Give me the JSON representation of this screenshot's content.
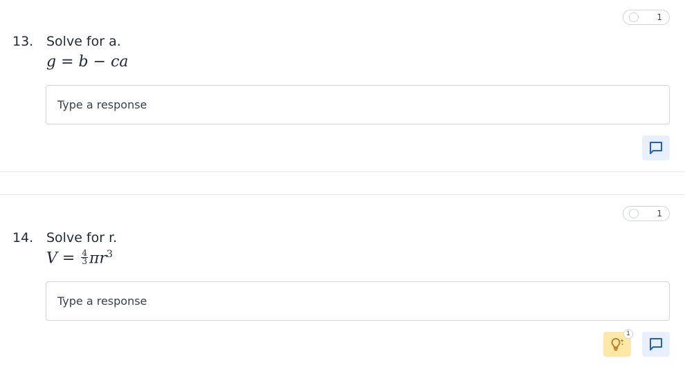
{
  "colors": {
    "accent": "#1a5fd6",
    "comment_bg": "#e8f0fe",
    "hint_bg": "#fde8a8",
    "hint_icon": "#b7791f",
    "border": "#d1d5db"
  },
  "questions": [
    {
      "points": "1",
      "number": "13.",
      "prompt": "Solve for a.",
      "equation": {
        "lhs": "g",
        "eq": "=",
        "b": "b",
        "minus": "−",
        "c": "c",
        "a": "a"
      },
      "response_placeholder": "Type a response",
      "comment_icon": "comment-icon"
    },
    {
      "points": "1",
      "number": "14.",
      "prompt": "Solve for r.",
      "equation": {
        "lhs": "V",
        "eq": "=",
        "frac_num": "4",
        "frac_den": "3",
        "pi": "π",
        "r": "r",
        "exp": "3"
      },
      "response_placeholder": "Type a response",
      "hint_icon": "lightbulb-icon",
      "hint_count": "1",
      "comment_icon": "comment-icon"
    }
  ]
}
